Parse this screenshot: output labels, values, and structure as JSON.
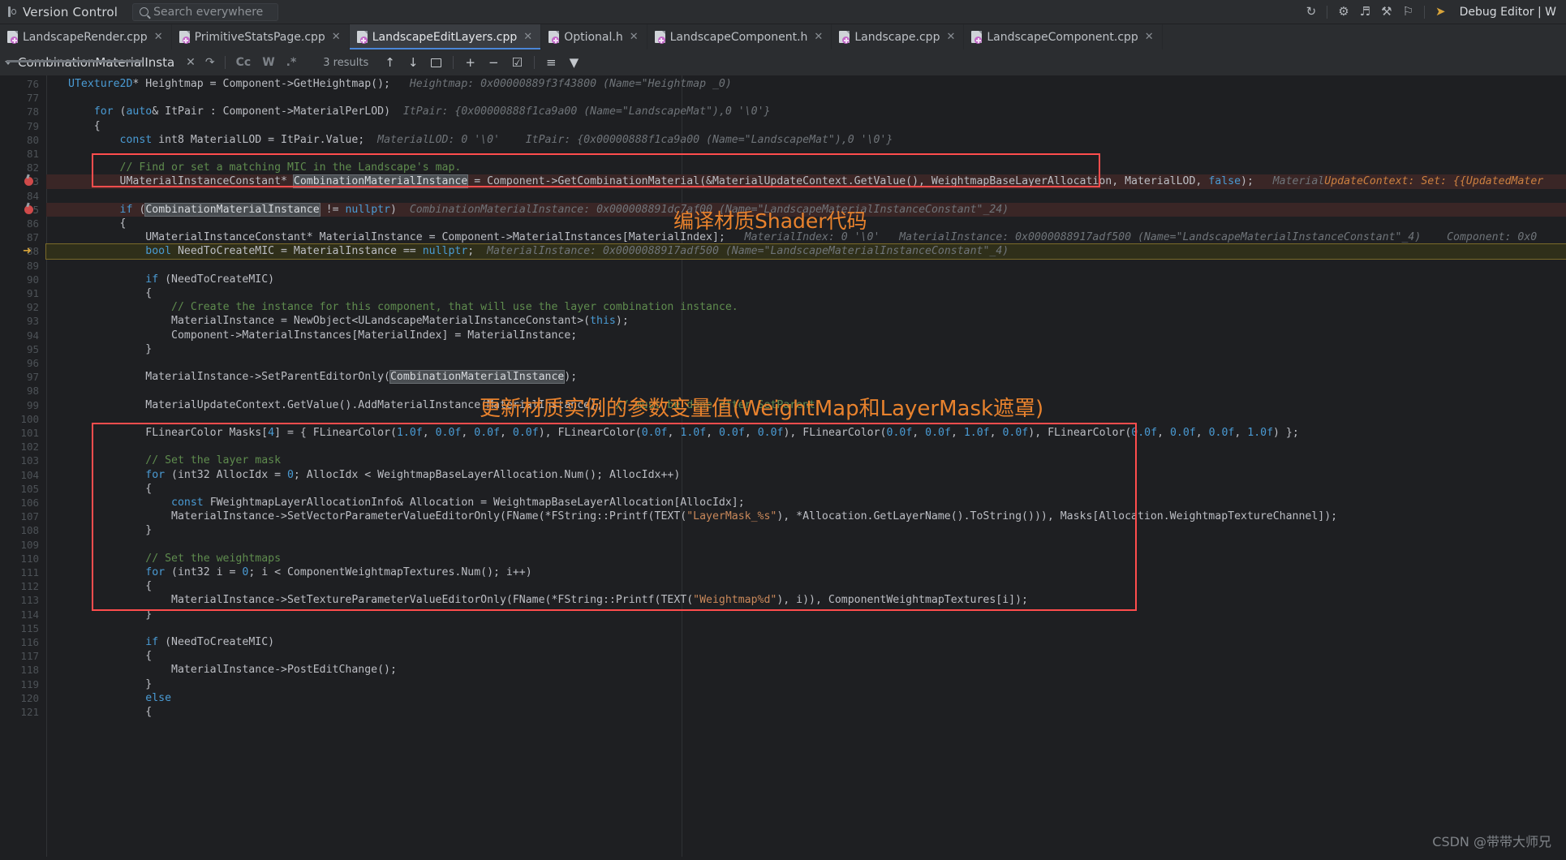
{
  "topbar": {
    "vcs_label": "Version Control",
    "search_placeholder": "Search everywhere",
    "icons": [
      "refresh-icon",
      "settings-run-icon",
      "run-debug-icon",
      "profiler-icon",
      "coverage-icon",
      "step-icon"
    ],
    "debug_label": "Debug Editor | W"
  },
  "tabs": [
    {
      "label": "LandscapeRender.cpp",
      "active": false
    },
    {
      "label": "PrimitiveStatsPage.cpp",
      "active": false
    },
    {
      "label": "LandscapeEditLayers.cpp",
      "active": true
    },
    {
      "label": "Optional.h",
      "active": false
    },
    {
      "label": "LandscapeComponent.h",
      "active": false
    },
    {
      "label": "Landscape.cpp",
      "active": false
    },
    {
      "label": "LandscapeComponent.cpp",
      "active": false
    }
  ],
  "findbar": {
    "query": "CombinationMaterialInsta",
    "close_icon": "close-icon",
    "history_icon": "history-icon",
    "match_case_label": "Cc",
    "words_label": "W",
    "regex_label": ".*",
    "results": "3 results",
    "prev_icon": "arrow-up-icon",
    "next_icon": "arrow-down-icon",
    "select_all_icon": "select-all-icon",
    "add_icon": "add-occurrence-icon",
    "remove_icon": "remove-occurrence-icon",
    "select_occurrences_icon": "select-occurrences-icon",
    "filter_icon": "filter-icon",
    "funnel_icon": "funnel-icon"
  },
  "annotations": [
    {
      "id": "shader-note",
      "text": "编译材质Shader代码",
      "color": "#e8822d"
    },
    {
      "id": "params-note",
      "text": "更新材质实例的参数变量值(WeightMap和LayerMask遮罩)",
      "color": "#e8822d"
    }
  ],
  "watermark": "CSDN @带带大师兄",
  "editor": {
    "first_line": 76,
    "lines": [
      {
        "n": 76,
        "state": "partial",
        "html": "<span class='kw'>UTexture2D</span>* Heightmap = Component-&gt;GetHeightmap();   <span class='hint'>Heightmap: 0x00000889f3f43800 (Name=\"Heightmap _0)</span>"
      },
      {
        "n": 77,
        "state": "normal",
        "html": ""
      },
      {
        "n": 78,
        "state": "normal",
        "html": "    <span class='kw'>for</span> (<span class='kw'>auto</span>&amp; ItPair : Component-&gt;MaterialPerLOD)  <span class='hint'>ItPair: {0x00000888f1ca9a00 (Name=\"LandscapeMat\"),0 '\\0'}</span>"
      },
      {
        "n": 79,
        "state": "normal",
        "html": "    {"
      },
      {
        "n": 80,
        "state": "normal",
        "html": "        <span class='kw'>const</span> int8 MaterialLOD = ItPair.Value;  <span class='hint'>MaterialLOD: 0 '\\0'    ItPair: {0x00000888f1ca9a00 (Name=\"LandscapeMat\"),0 '\\0'}</span>"
      },
      {
        "n": 81,
        "state": "normal",
        "html": ""
      },
      {
        "n": 82,
        "state": "normal",
        "html": "        <span class='cm'>// Find or set a matching MIC in the Landscape's map.</span>"
      },
      {
        "n": 83,
        "state": "hl",
        "bp": true,
        "html": "        UMaterialInstanceConstant* <span class='hl'>CombinationMaterialInstance</span> = Component-&gt;GetCombinationMaterial(&amp;MaterialUpdateContext.GetValue(), WeightmapBaseLayerAllocation, MaterialLOD, <span class='kw'>false</span>);   <span class='hint'>Material</span><span class='hint-or'>UpdateContext: Set: {{UpdatedMater</span>"
      },
      {
        "n": 84,
        "state": "normal",
        "html": ""
      },
      {
        "n": 85,
        "state": "hl",
        "bp": true,
        "html": "        <span class='kw'>if</span> (<span class='hl'>CombinationMaterialInstance</span> != <span class='kw'>nullptr</span>)  <span class='hint'>CombinationMaterialInstance: 0x000008891dc7af00 (Name=\"LandscapeMaterialInstanceConstant\"_24)</span>"
      },
      {
        "n": 86,
        "state": "normal",
        "html": "        {"
      },
      {
        "n": 87,
        "state": "normal",
        "html": "            UMaterialInstanceConstant* MaterialInstance = Component-&gt;MaterialInstances[MaterialIndex];   <span class='hint'>MaterialIndex: 0 '\\0'   MaterialInstance: 0x0000088917adf500 (Name=\"LandscapeMaterialInstanceConstant\"_4)    Component: 0x0</span>"
      },
      {
        "n": 88,
        "state": "cur",
        "arrow": true,
        "html": "            <span class='kw'>bool</span> NeedToCreateMIC = MaterialInstance == <span class='kw'>nullptr</span>;  <span class='hint'>MaterialInstance: 0x0000088917adf500 (Name=\"LandscapeMaterialInstanceConstant\"_4)</span>"
      },
      {
        "n": 89,
        "state": "normal",
        "html": ""
      },
      {
        "n": 90,
        "state": "normal",
        "html": "            <span class='kw'>if</span> (NeedToCreateMIC)"
      },
      {
        "n": 91,
        "state": "normal",
        "html": "            {"
      },
      {
        "n": 92,
        "state": "normal",
        "html": "                <span class='cm'>// Create the instance for this component, that will use the layer combination instance.</span>"
      },
      {
        "n": 93,
        "state": "normal",
        "html": "                MaterialInstance = NewObject&lt;ULandscapeMaterialInstanceConstant&gt;(<span class='kw'>this</span>);"
      },
      {
        "n": 94,
        "state": "normal",
        "html": "                Component-&gt;MaterialInstances[MaterialIndex] = MaterialInstance;"
      },
      {
        "n": 95,
        "state": "normal",
        "html": "            }"
      },
      {
        "n": 96,
        "state": "normal",
        "html": ""
      },
      {
        "n": 97,
        "state": "normal",
        "html": "            MaterialInstance-&gt;SetParentEditorOnly(<span class='hl'>CombinationMaterialInstance</span>);"
      },
      {
        "n": 98,
        "state": "normal",
        "html": ""
      },
      {
        "n": 99,
        "state": "normal",
        "html": "            MaterialUpdateContext.GetValue().AddMaterialInstance(MaterialInstance);  <span class='cm'>// must be done after SetParent</span>"
      },
      {
        "n": 100,
        "state": "normal",
        "html": ""
      },
      {
        "n": 101,
        "state": "normal",
        "html": "            FLinearColor Masks[<span class='num'>4</span>] = { FLinearColor(<span class='num'>1.0f</span>, <span class='num'>0.0f</span>, <span class='num'>0.0f</span>, <span class='num'>0.0f</span>), FLinearColor(<span class='num'>0.0f</span>, <span class='num'>1.0f</span>, <span class='num'>0.0f</span>, <span class='num'>0.0f</span>), FLinearColor(<span class='num'>0.0f</span>, <span class='num'>0.0f</span>, <span class='num'>1.0f</span>, <span class='num'>0.0f</span>), FLinearColor(<span class='num'>0.0f</span>, <span class='num'>0.0f</span>, <span class='num'>0.0f</span>, <span class='num'>1.0f</span>) };"
      },
      {
        "n": 102,
        "state": "normal",
        "html": ""
      },
      {
        "n": 103,
        "state": "normal",
        "html": "            <span class='cm'>// Set the layer mask</span>"
      },
      {
        "n": 104,
        "state": "normal",
        "html": "            <span class='kw'>for</span> (int32 AllocIdx = <span class='num'>0</span>; AllocIdx &lt; WeightmapBaseLayerAllocation.Num(); AllocIdx++)"
      },
      {
        "n": 105,
        "state": "normal",
        "html": "            {"
      },
      {
        "n": 106,
        "state": "normal",
        "html": "                <span class='kw'>const</span> FWeightmapLayerAllocationInfo&amp; Allocation = WeightmapBaseLayerAllocation[AllocIdx];"
      },
      {
        "n": 107,
        "state": "normal",
        "html": "                MaterialInstance-&gt;SetVectorParameterValueEditorOnly(FName(*FString::Printf(TEXT(<span class='str'>\"LayerMask_%s\"</span>), *Allocation.GetLayerName().ToString())), Masks[Allocation.WeightmapTextureChannel]);"
      },
      {
        "n": 108,
        "state": "normal",
        "html": "            }"
      },
      {
        "n": 109,
        "state": "normal",
        "html": ""
      },
      {
        "n": 110,
        "state": "normal",
        "html": "            <span class='cm'>// Set the weightmaps</span>"
      },
      {
        "n": 111,
        "state": "normal",
        "html": "            <span class='kw'>for</span> (int32 i = <span class='num'>0</span>; i &lt; ComponentWeightmapTextures.Num(); i++)"
      },
      {
        "n": 112,
        "state": "normal",
        "html": "            {"
      },
      {
        "n": 113,
        "state": "normal",
        "html": "                MaterialInstance-&gt;SetTextureParameterValueEditorOnly(FName(*FString::Printf(TEXT(<span class='str'>\"Weightmap%d\"</span>), i)), ComponentWeightmapTextures[i]);"
      },
      {
        "n": 114,
        "state": "normal",
        "html": "            }"
      },
      {
        "n": 115,
        "state": "normal",
        "html": ""
      },
      {
        "n": 116,
        "state": "normal",
        "html": "            <span class='kw'>if</span> (NeedToCreateMIC)"
      },
      {
        "n": 117,
        "state": "normal",
        "html": "            {"
      },
      {
        "n": 118,
        "state": "normal",
        "html": "                MaterialInstance-&gt;PostEditChange();"
      },
      {
        "n": 119,
        "state": "normal",
        "html": "            }"
      },
      {
        "n": 120,
        "state": "normal",
        "html": "            <span class='kw'>else</span>"
      },
      {
        "n": 121,
        "state": "normal",
        "html": "            {"
      }
    ]
  }
}
